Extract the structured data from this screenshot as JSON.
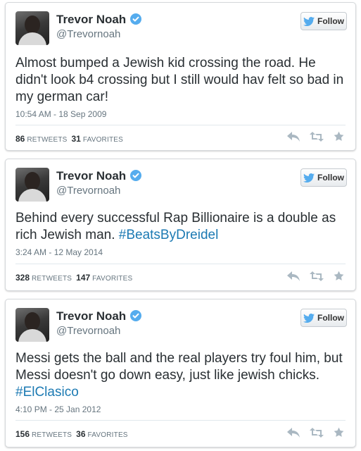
{
  "tweets": [
    {
      "name": "Trevor Noah",
      "handle": "@Trevornoah",
      "follow_label": "Follow",
      "text_plain": "Almost bumped a Jewish kid crossing the road. He didn't look b4 crossing but I still would hav felt so bad in my german car!",
      "hashtag": "",
      "timestamp": "10:54 AM - 18 Sep 2009",
      "retweets_count": "86",
      "retweets_label": "RETWEETS",
      "favorites_count": "31",
      "favorites_label": "FAVORITES"
    },
    {
      "name": "Trevor Noah",
      "handle": "@Trevornoah",
      "follow_label": "Follow",
      "text_plain": "Behind every successful Rap Billionaire is a double as rich Jewish man. ",
      "hashtag": "#BeatsByDreidel",
      "timestamp": "3:24 AM - 12 May 2014",
      "retweets_count": "328",
      "retweets_label": "RETWEETS",
      "favorites_count": "147",
      "favorites_label": "FAVORITES"
    },
    {
      "name": "Trevor Noah",
      "handle": "@Trevornoah",
      "follow_label": "Follow",
      "text_plain": "Messi gets the ball and the real players try foul him, but Messi doesn't go down easy, just like jewish chicks. ",
      "hashtag": "#ElClasico",
      "timestamp": "4:10 PM - 25 Jan 2012",
      "retweets_count": "156",
      "retweets_label": "RETWEETS",
      "favorites_count": "36",
      "favorites_label": "FAVORITES"
    }
  ],
  "icons": {
    "verified": "verified-badge-icon",
    "follow": "twitter-bird-icon",
    "reply": "reply-icon",
    "retweet": "retweet-icon",
    "favorite": "star-icon"
  },
  "colors": {
    "verified": "#55acee",
    "hashtag": "#1c7ab3",
    "muted": "#66757f",
    "icon": "#aab8c2"
  }
}
